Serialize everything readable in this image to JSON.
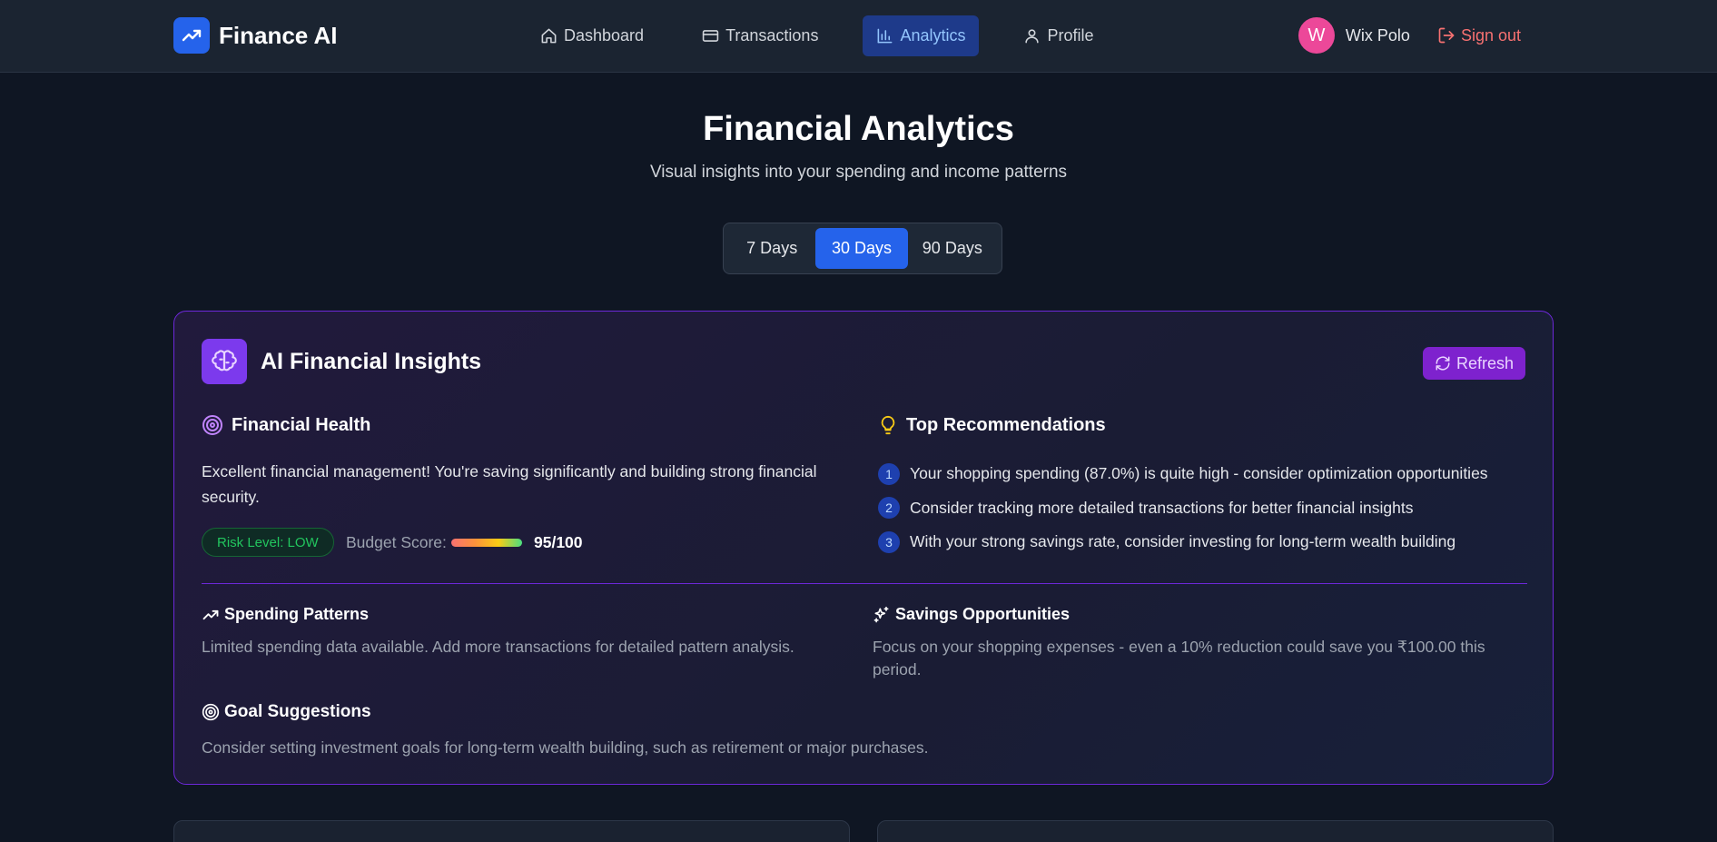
{
  "app": {
    "name": "Finance AI",
    "logo_icon": "trending-up-icon"
  },
  "nav": {
    "items": [
      {
        "label": "Dashboard",
        "icon": "home-icon"
      },
      {
        "label": "Transactions",
        "icon": "credit-card-icon"
      },
      {
        "label": "Analytics",
        "icon": "bar-chart-icon",
        "active": true
      },
      {
        "label": "Profile",
        "icon": "user-icon"
      }
    ]
  },
  "user": {
    "initial": "W",
    "name": "Wix Polo",
    "signout_label": "Sign out"
  },
  "header": {
    "title": "Financial Analytics",
    "subtitle": "Visual insights into your spending and income patterns"
  },
  "ranges": {
    "options": [
      "7 Days",
      "30 Days",
      "90 Days"
    ],
    "selected": "30 Days"
  },
  "insights": {
    "title": "AI Financial Insights",
    "refresh_label": "Refresh",
    "health": {
      "title": "Financial Health",
      "text": "Excellent financial management! You're saving significantly and building strong financial security.",
      "risk_label": "Risk Level: LOW",
      "budget_label": "Budget Score:",
      "budget_score": "95/100",
      "budget_value": 95
    },
    "recommendations": {
      "title": "Top Recommendations",
      "items": [
        {
          "num": "1",
          "text": "Your shopping spending (87.0%) is quite high - consider optimization opportunities"
        },
        {
          "num": "2",
          "text": "Consider tracking more detailed transactions for better financial insights"
        },
        {
          "num": "3",
          "text": "With your strong savings rate, consider investing for long-term wealth building"
        }
      ]
    },
    "spending_patterns": {
      "title": "Spending Patterns",
      "text": "Limited spending data available. Add more transactions for detailed pattern analysis."
    },
    "savings_opportunities": {
      "title": "Savings Opportunities",
      "text": "Focus on your shopping expenses - even a 10% reduction could save you ₹100.00 this period."
    },
    "goal_suggestions": {
      "title": "Goal Suggestions",
      "text": "Consider setting investment goals for long-term wealth building, such as retirement or major purchases."
    }
  },
  "colors": {
    "accent": "#2563eb",
    "purple": "#7c3aed",
    "danger": "#f87171",
    "success": "#22c55e"
  }
}
